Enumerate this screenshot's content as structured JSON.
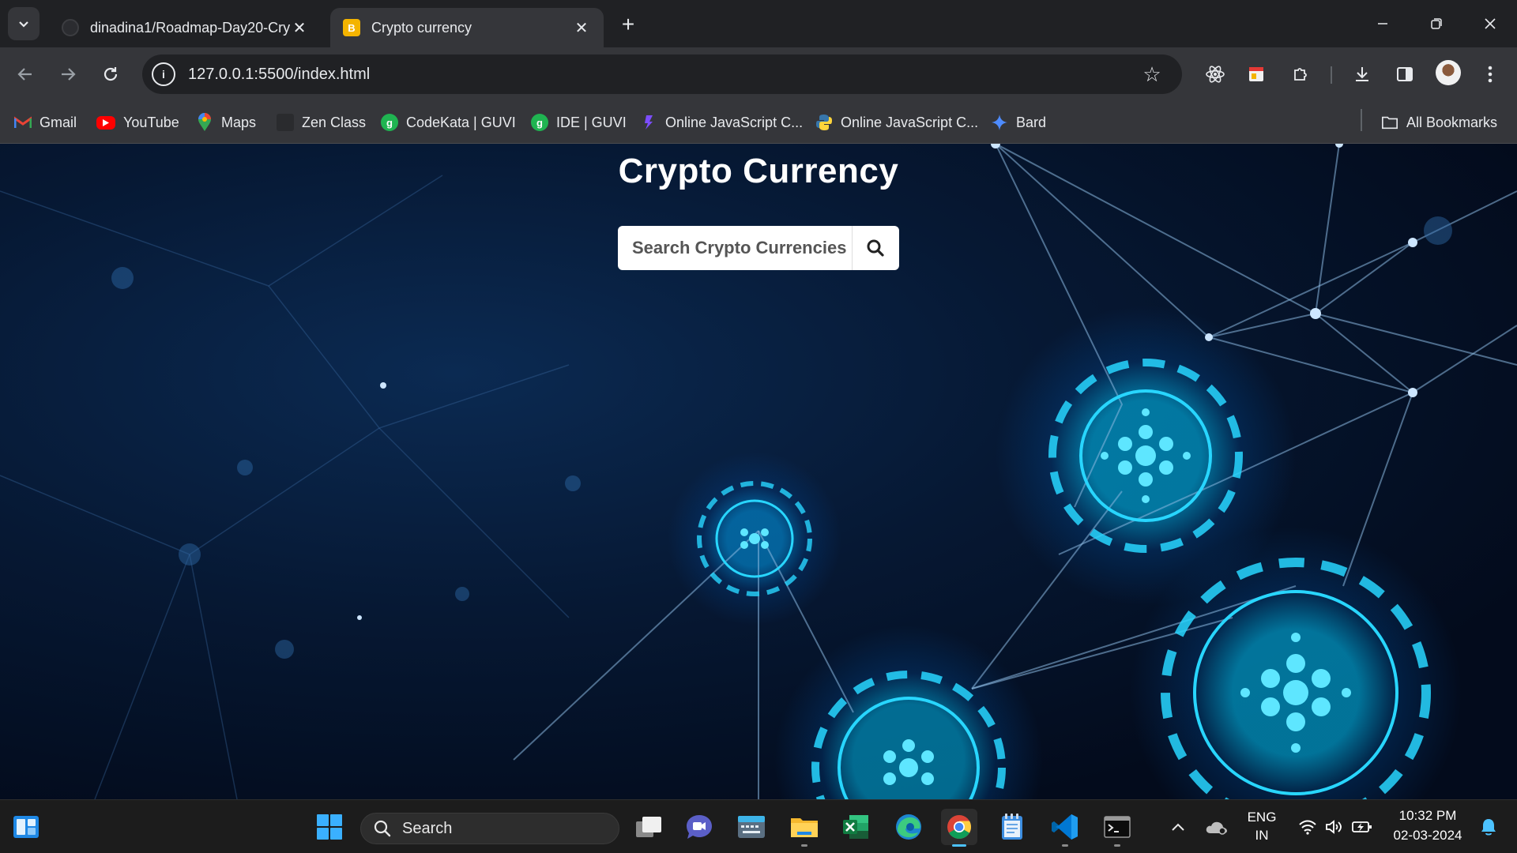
{
  "browser": {
    "tabs": [
      {
        "label": "dinadina1/Roadmap-Day20-Cry",
        "active": false
      },
      {
        "label": "Crypto currency",
        "active": true
      }
    ],
    "address": {
      "url": "127.0.0.1:5500/index.html"
    },
    "bookmarks": [
      {
        "label": "Gmail",
        "icon": "gmail-icon"
      },
      {
        "label": "YouTube",
        "icon": "youtube-icon"
      },
      {
        "label": "Maps",
        "icon": "maps-icon"
      },
      {
        "label": "Zen Class",
        "icon": "zen-class-icon"
      },
      {
        "label": "CodeKata | GUVI",
        "icon": "guvi-icon"
      },
      {
        "label": "IDE | GUVI",
        "icon": "guvi-icon"
      },
      {
        "label": "Online JavaScript C...",
        "icon": "javascript-icon"
      },
      {
        "label": "Online JavaScript C...",
        "icon": "python-icon"
      },
      {
        "label": "Bard",
        "icon": "bard-icon"
      }
    ],
    "all_bookmarks_label": "All Bookmarks"
  },
  "page": {
    "title": "Crypto Currency",
    "search_placeholder": "Search Crypto Currencies"
  },
  "taskbar": {
    "search_label": "Search",
    "language": {
      "line1": "ENG",
      "line2": "IN"
    },
    "time": "10:32 PM",
    "date": "02-03-2024"
  },
  "colors": {
    "browser_bg": "#202124",
    "toolbar_bg": "#35363a",
    "page_bg": "#061833",
    "accent_cyan": "#00c8ff",
    "taskbar_bg": "#1c1c1c"
  }
}
